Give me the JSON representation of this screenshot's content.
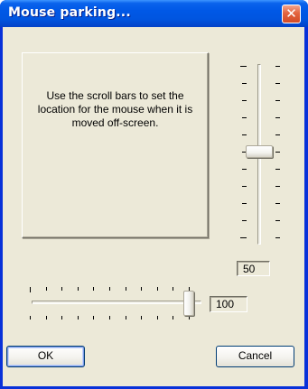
{
  "window": {
    "title": "Mouse parking...",
    "close_glyph": "✕",
    "close_icon": "close-icon"
  },
  "info": {
    "text": "Use the scroll bars to set the location for the mouse when it is moved off-screen."
  },
  "vertical_slider": {
    "value_text": "50",
    "position_fraction": 0.5
  },
  "horizontal_slider": {
    "value_text": "100",
    "position_fraction": 1.0
  },
  "buttons": {
    "ok_label": "OK",
    "cancel_label": "Cancel"
  },
  "colors": {
    "titlebar": "#0058e6",
    "client": "#ece9d8",
    "close_button": "#e3643f"
  }
}
